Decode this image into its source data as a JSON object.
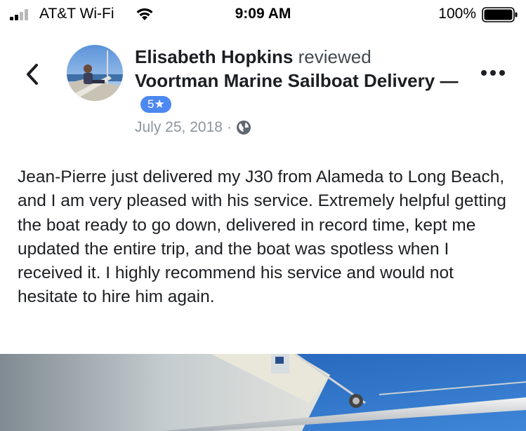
{
  "status_bar": {
    "carrier": "AT&T Wi-Fi",
    "time": "9:09 AM",
    "battery_percent": "100%",
    "icons": [
      "signal-bars-icon",
      "wifi-icon",
      "battery-icon"
    ]
  },
  "post": {
    "author": "Elisabeth Hopkins",
    "action": "reviewed",
    "page_name": "Voortman Marine Sailboat Delivery",
    "separator": "—",
    "rating": "5★",
    "date": "July 25, 2018",
    "meta_separator": "·",
    "privacy_icon": "globe-icon",
    "review_text": "Jean-Pierre just delivered my J30 from Alameda to Long Beach, and I am very pleased with his service. Extremely helpful getting the boat ready to go down, delivered in record time, kept me updated the entire trip, and the boat was spotless when I received it. I highly recommend his service and would not hesitate to hire him again."
  },
  "colors": {
    "rating_badge": "#4c88f0",
    "meta_text": "#8d949e",
    "body_text": "#1c1e21"
  }
}
